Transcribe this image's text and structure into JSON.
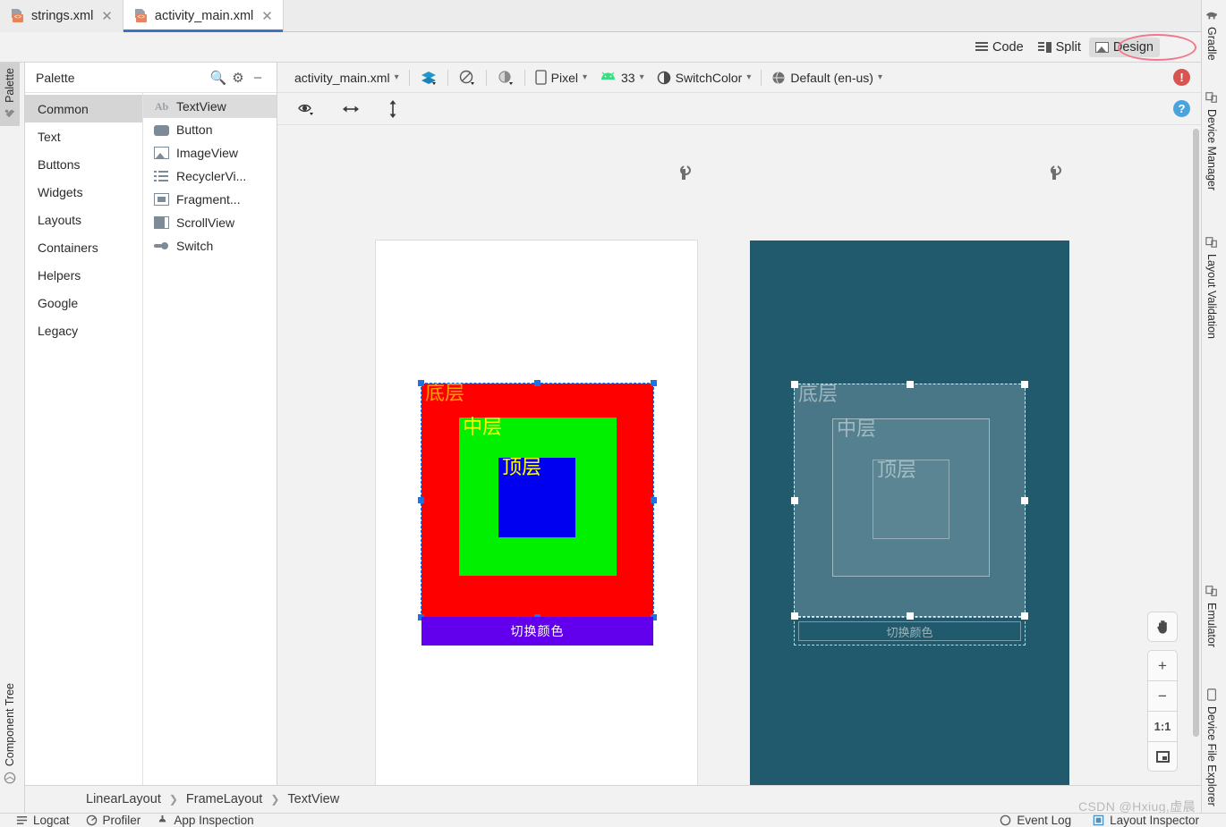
{
  "tabs": [
    {
      "label": "strings.xml",
      "icon": "xml-file-icon",
      "active": false
    },
    {
      "label": "activity_main.xml",
      "icon": "xml-file-icon",
      "active": true
    }
  ],
  "mode_bar": {
    "code_label": "Code",
    "split_label": "Split",
    "design_label": "Design",
    "selected": "Design",
    "annotation_color": "#f1788a"
  },
  "left_strip": [
    {
      "label": "Palette",
      "icon": "palette-icon",
      "active": true
    },
    {
      "label": "Component Tree",
      "icon": "component-tree-icon",
      "active": false
    }
  ],
  "right_strip": [
    {
      "label": "Gradle",
      "icon": "gradle-elephant-icon"
    },
    {
      "label": "Device Manager",
      "icon": "device-manager-icon"
    },
    {
      "label": "Layout Validation",
      "icon": "layout-validation-icon"
    },
    {
      "label": "Emulator",
      "icon": "emulator-icon"
    },
    {
      "label": "Device File Explorer",
      "icon": "device-file-explorer-icon"
    }
  ],
  "palette": {
    "title": "Palette",
    "search_icon": "search-icon",
    "settings_icon": "gear-icon",
    "minimize_icon": "minimize-icon",
    "categories": [
      {
        "label": "Common",
        "selected": true
      },
      {
        "label": "Text",
        "selected": false
      },
      {
        "label": "Buttons",
        "selected": false
      },
      {
        "label": "Widgets",
        "selected": false
      },
      {
        "label": "Layouts",
        "selected": false
      },
      {
        "label": "Containers",
        "selected": false
      },
      {
        "label": "Helpers",
        "selected": false
      },
      {
        "label": "Google",
        "selected": false
      },
      {
        "label": "Legacy",
        "selected": false
      }
    ],
    "items": [
      {
        "label": "TextView",
        "icon": "textview-icon",
        "selected": true
      },
      {
        "label": "Button",
        "icon": "button-icon",
        "selected": false
      },
      {
        "label": "ImageView",
        "icon": "imageview-icon",
        "selected": false
      },
      {
        "label": "RecyclerVi...",
        "icon": "recyclerview-icon",
        "selected": false
      },
      {
        "label": "Fragment...",
        "icon": "fragment-icon",
        "selected": false
      },
      {
        "label": "ScrollView",
        "icon": "scrollview-icon",
        "selected": false
      },
      {
        "label": "Switch",
        "icon": "switch-icon",
        "selected": false
      }
    ]
  },
  "design_toolbar": {
    "file_label": "activity_main.xml",
    "layers_icon": "layers-icon",
    "orientation_icon": "orientation-icon",
    "theme_mode_icon": "night-mode-icon",
    "device_label": "Pixel",
    "api_label": "33",
    "theme_label": "SwitchColor",
    "locale_label": "Default (en-us)",
    "error_badge": "!",
    "help_badge": "?"
  },
  "design_toolbar2": {
    "visibility_icon": "eye-icon",
    "width_icon": "horizontal-resize-icon",
    "height_icon": "vertical-resize-icon"
  },
  "preview": {
    "design_label": "design-preview",
    "blueprint_label": "blueprint-preview",
    "wrench_icon": "wrench-icon",
    "layers": [
      {
        "name": "bottom-layer",
        "text": "底层",
        "bg": "#ff0000",
        "text_color": "#ffa000"
      },
      {
        "name": "middle-layer",
        "text": "中层",
        "bg": "#00f000",
        "text_color": "#ffff00"
      },
      {
        "name": "top-layer",
        "text": "顶层",
        "bg": "#0000f0",
        "text_color": "#ffff00"
      }
    ],
    "button_text": "切换颜色",
    "button_bg": "#6200ee",
    "blueprint_bg": "#215a6d",
    "selection_color": "#1a73e8"
  },
  "zoom_controls": [
    {
      "label": "✋",
      "name": "pan-tool-button"
    },
    {
      "label": "+",
      "name": "zoom-in-button"
    },
    {
      "label": "−",
      "name": "zoom-out-button"
    },
    {
      "label": "1:1",
      "name": "zoom-actual-size-button"
    },
    {
      "label": "",
      "name": "zoom-to-fit-button"
    }
  ],
  "breadcrumb": [
    "LinearLayout",
    "FrameLayout",
    "TextView"
  ],
  "status_bar": {
    "left_items": [
      {
        "label": "Logcat",
        "icon": "logcat-icon"
      },
      {
        "label": "Profiler",
        "icon": "profiler-icon"
      },
      {
        "label": "App Inspection",
        "icon": "app-inspection-icon"
      }
    ],
    "right_items": [
      {
        "label": "Event Log",
        "icon": "event-log-icon"
      },
      {
        "label": "Layout Inspector",
        "icon": "layout-inspector-icon"
      }
    ]
  },
  "watermark": "CSDN @Hxiug,虚晨"
}
